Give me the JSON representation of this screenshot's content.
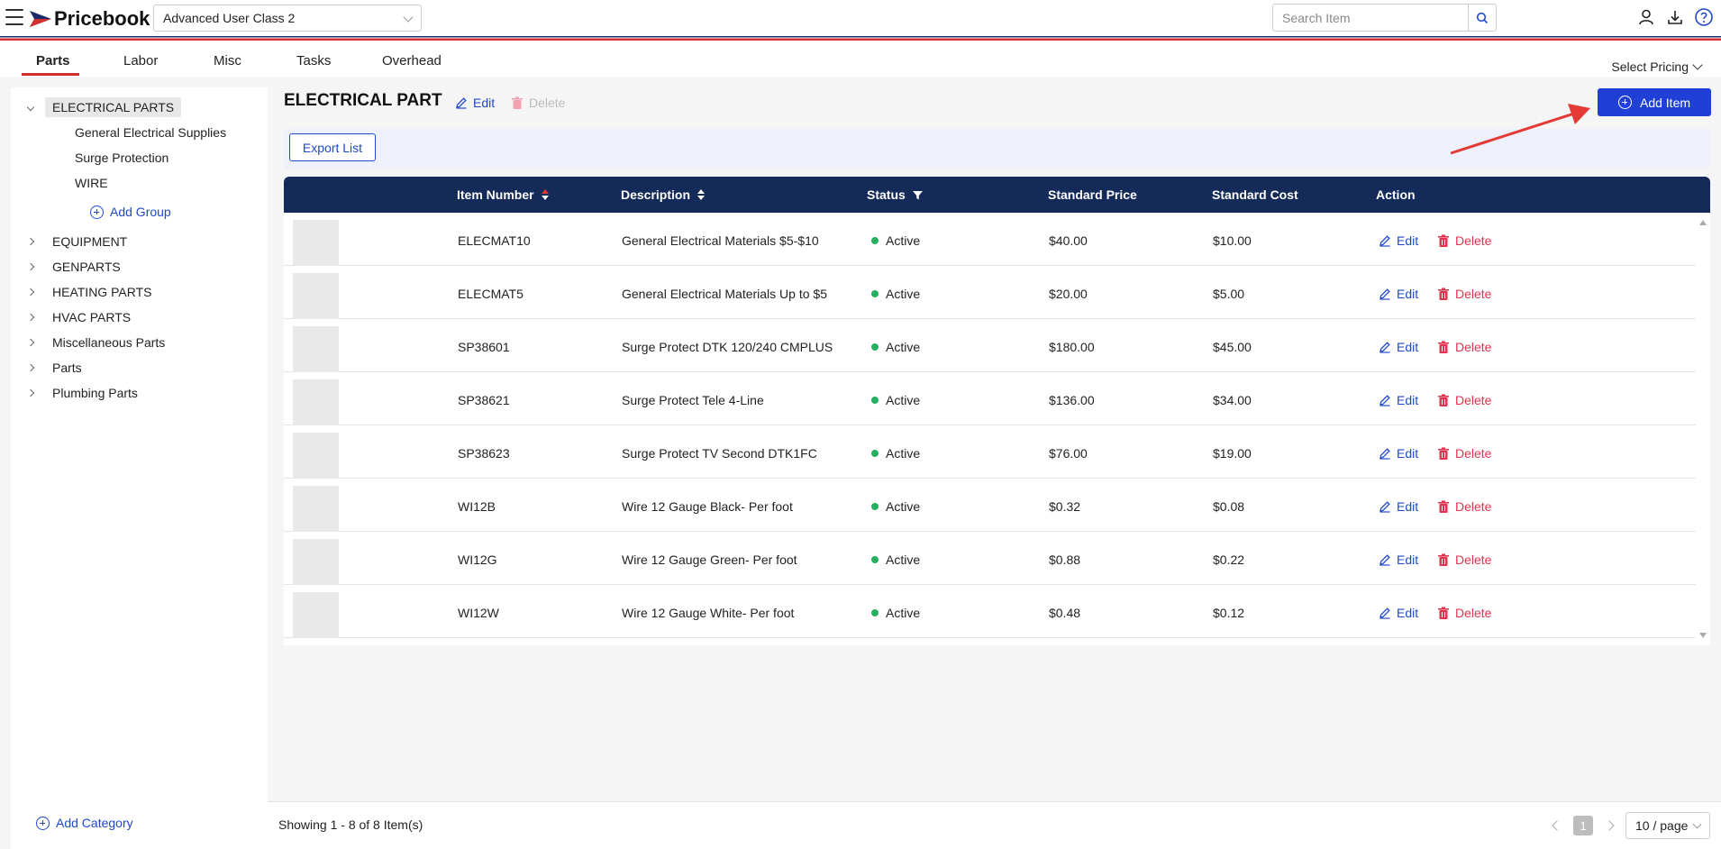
{
  "header": {
    "logo_text": "Pricebook",
    "class_select_value": "Advanced User Class 2",
    "search_placeholder": "Search Item"
  },
  "tabs": [
    {
      "label": "Parts",
      "active": true
    },
    {
      "label": "Labor"
    },
    {
      "label": "Misc"
    },
    {
      "label": "Tasks"
    },
    {
      "label": "Overhead"
    }
  ],
  "select_pricing_label": "Select Pricing",
  "sidebar": {
    "selected_category": "ELECTRICAL PARTS",
    "sub_items": [
      "General Electrical Supplies",
      "Surge Protection",
      "WIRE"
    ],
    "add_group_label": "Add Group",
    "categories": [
      "EQUIPMENT",
      "GENPARTS",
      "HEATING PARTS",
      "HVAC PARTS",
      "Miscellaneous Parts",
      "Parts",
      "Plumbing Parts"
    ],
    "add_category_label": "Add Category"
  },
  "main": {
    "title": "ELECTRICAL PART",
    "edit_label": "Edit",
    "delete_label": "Delete",
    "add_item_label": "Add Item",
    "export_label": "Export List"
  },
  "table": {
    "columns": [
      "Item Number",
      "Description",
      "Status",
      "Standard Price",
      "Standard Cost",
      "Action"
    ],
    "rows": [
      {
        "item": "ELECMAT10",
        "desc": "General Electrical Materials $5-$10",
        "status": "Active",
        "price": "$40.00",
        "cost": "$10.00"
      },
      {
        "item": "ELECMAT5",
        "desc": "General Electrical Materials Up to $5",
        "status": "Active",
        "price": "$20.00",
        "cost": "$5.00"
      },
      {
        "item": "SP38601",
        "desc": "Surge Protect DTK 120/240 CMPLUS",
        "status": "Active",
        "price": "$180.00",
        "cost": "$45.00"
      },
      {
        "item": "SP38621",
        "desc": "Surge Protect Tele 4-Line",
        "status": "Active",
        "price": "$136.00",
        "cost": "$34.00"
      },
      {
        "item": "SP38623",
        "desc": "Surge Protect TV Second DTK1FC",
        "status": "Active",
        "price": "$76.00",
        "cost": "$19.00"
      },
      {
        "item": "WI12B",
        "desc": "Wire 12 Gauge Black- Per foot",
        "status": "Active",
        "price": "$0.32",
        "cost": "$0.08"
      },
      {
        "item": "WI12G",
        "desc": "Wire 12 Gauge Green- Per foot",
        "status": "Active",
        "price": "$0.88",
        "cost": "$0.22"
      },
      {
        "item": "WI12W",
        "desc": "Wire 12 Gauge White- Per foot",
        "status": "Active",
        "price": "$0.48",
        "cost": "$0.12"
      }
    ],
    "edit_label": "Edit",
    "delete_label": "Delete"
  },
  "footer": {
    "showing": "Showing 1 - 8 of 8 Item(s)",
    "current_page": "1",
    "page_size": "10 / page"
  },
  "colors": {
    "brand_red": "#d32f2f",
    "brand_navy": "#142a59",
    "link_blue": "#2149c9",
    "delete_red": "#e0334e",
    "active_green": "#27ae60"
  }
}
